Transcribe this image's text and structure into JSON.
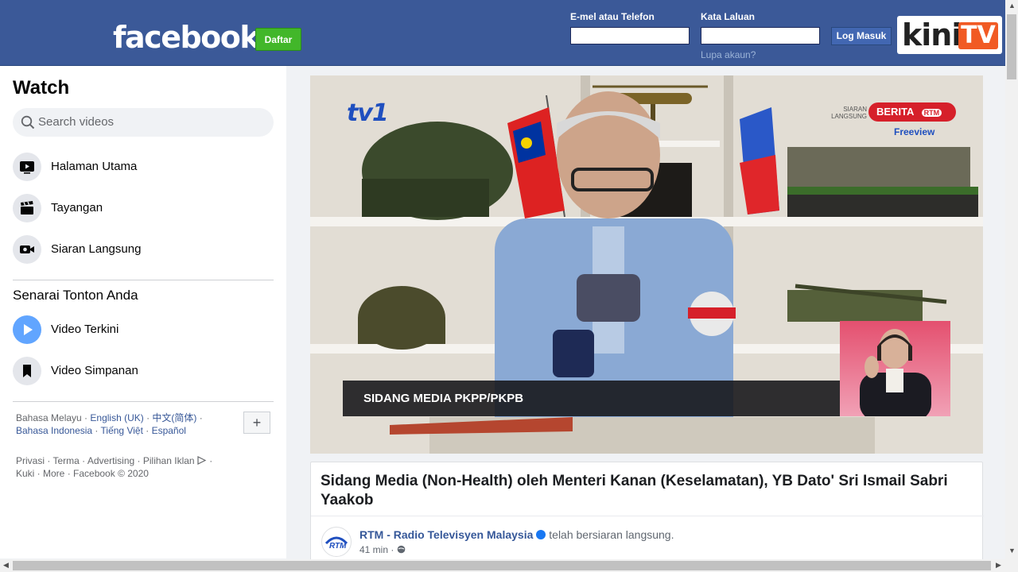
{
  "header": {
    "logo": "facebook",
    "signup_label": "Daftar",
    "email_label": "E-mel atau Telefon",
    "email_value": "",
    "password_label": "Kata Laluan",
    "password_value": "",
    "login_label": "Log Masuk",
    "forgot_label": "Lupa akaun?",
    "brand_kini": "kini",
    "brand_tv": "TV",
    "colors": {
      "bar": "#3b5998",
      "signup": "#42b72a",
      "brand_accent": "#f15a24"
    }
  },
  "sidebar": {
    "title": "Watch",
    "search_placeholder": "Search videos",
    "items": [
      {
        "label": "Halaman Utama",
        "icon": "play-screen-icon"
      },
      {
        "label": "Tayangan",
        "icon": "clapperboard-icon"
      },
      {
        "label": "Siaran Langsung",
        "icon": "live-camera-icon"
      }
    ],
    "watchlist_title": "Senarai Tonton Anda",
    "watchlist": [
      {
        "label": "Video Terkini",
        "icon": "play-circle-icon"
      },
      {
        "label": "Video Simpanan",
        "icon": "bookmark-icon"
      }
    ],
    "languages": {
      "current": "Bahasa Melayu",
      "others": [
        "English (UK)",
        "中文(简体)",
        "Bahasa Indonesia",
        "Tiếng Việt",
        "Español"
      ]
    },
    "add_language": "+",
    "footer_links": [
      "Privasi",
      "Terma",
      "Advertising",
      "Pilihan Iklan",
      "Kuki",
      "More"
    ],
    "copyright": "Facebook © 2020"
  },
  "video": {
    "channel_logo": "tv1",
    "corner_badge": "BERITA",
    "corner_network": "RTM",
    "corner_status": "SIARAN LANGSUNG",
    "freeview": "Freeview",
    "lower_third": "SIDANG MEDIA PKPP/PKPB"
  },
  "post": {
    "title": "Sidang Media (Non-Health) oleh Menteri Kanan (Keselamatan), YB Dato' Sri Ismail Sabri Yaakob",
    "page_name": "RTM - Radio Televisyen Malaysia",
    "action": "telah bersiaran langsung.",
    "time": "41 min",
    "avatar_text": "RTM"
  }
}
